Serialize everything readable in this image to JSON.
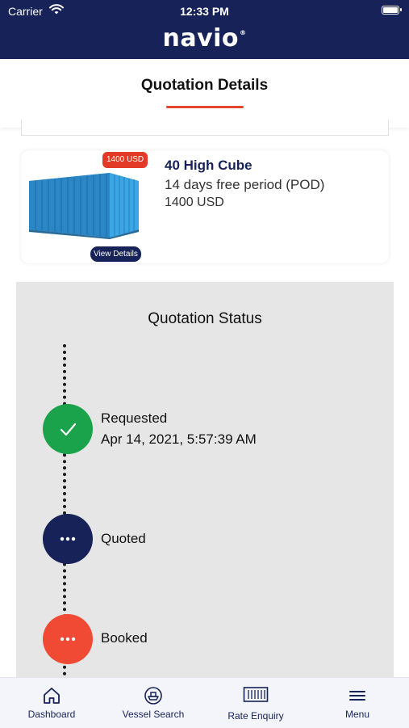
{
  "status_bar": {
    "carrier": "Carrier",
    "time": "12:33 PM"
  },
  "brand": {
    "logo_text": "navio",
    "registered_mark": "®"
  },
  "header": {
    "title": "Quotation Details"
  },
  "container_card": {
    "price_badge": "1400 USD",
    "view_details_label": "View Details",
    "title": "40 High Cube",
    "free_period": "14 days free period (POD)",
    "price": "1400 USD"
  },
  "quotation_status": {
    "title": "Quotation Status",
    "steps": [
      {
        "label": "Requested",
        "timestamp": "Apr 14, 2021, 5:57:39 AM",
        "state": "done",
        "color": "#1aa34a"
      },
      {
        "label": "Quoted",
        "state": "pending",
        "color": "#172259"
      },
      {
        "label": "Booked",
        "state": "pending",
        "color": "#f04a35"
      }
    ]
  },
  "tab_bar": {
    "items": [
      {
        "label": "Dashboard",
        "icon": "home-icon"
      },
      {
        "label": "Vessel Search",
        "icon": "ship-icon"
      },
      {
        "label": "Rate Enquiry",
        "icon": "container-icon"
      },
      {
        "label": "Menu",
        "icon": "menu-icon"
      }
    ]
  },
  "colors": {
    "brand_navy": "#172259",
    "accent_red": "#e5452f",
    "success_green": "#1aa34a"
  }
}
